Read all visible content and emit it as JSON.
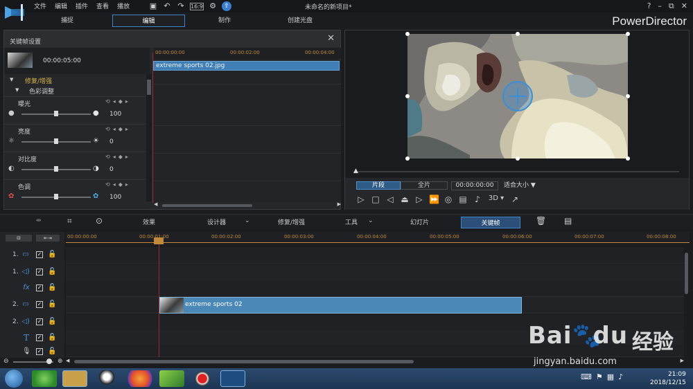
{
  "window": {
    "title": "未命名的新项目*",
    "brand": "PowerDirector",
    "controls": [
      "?",
      "–",
      "⧉",
      "✕"
    ]
  },
  "menu": [
    "文件",
    "编辑",
    "插件",
    "查看",
    "播放"
  ],
  "mode_tabs": [
    {
      "label": "捕捉",
      "active": false
    },
    {
      "label": "编辑",
      "active": true
    },
    {
      "label": "制作",
      "active": false
    },
    {
      "label": "创建光盘",
      "active": false
    }
  ],
  "keyframe_panel": {
    "title": "关键帧设置",
    "clip_time": "00:00:05:00",
    "ruler": [
      "00:00:00:00",
      "00:00:02:00",
      "00:00:04:00"
    ],
    "clip_name": "extreme sports 02.jpg",
    "section": "修复/增强",
    "subsection": "色彩调整",
    "properties": [
      {
        "name": "曝光",
        "value": "100",
        "level": 0.5
      },
      {
        "name": "亮度",
        "value": "0",
        "level": 0.5
      },
      {
        "name": "对比度",
        "value": "0",
        "level": 0.5
      },
      {
        "name": "色调",
        "value": "100",
        "level": 0.5
      }
    ]
  },
  "preview": {
    "segment_tabs": [
      {
        "label": "片段",
        "active": true
      },
      {
        "label": "全片",
        "active": false
      }
    ],
    "timecode": "00:00:00:00",
    "fit": "适合大小",
    "mode_3d": "3D"
  },
  "timeline_toolbar": {
    "effects": "效果",
    "designer": "设计器",
    "fix_enhance": "修复/增强",
    "tools": "工具",
    "slideshow": "幻灯片",
    "keyframe": "关键帧"
  },
  "timeline": {
    "ruler": [
      "00:00:00:00",
      "00:00:01:00",
      "00:00:02:00",
      "00:00:03:00",
      "00:00:04:00",
      "00:00:05:00",
      "00:00:06:00",
      "00:00:07:00",
      "00:00:08:00"
    ],
    "tracks": [
      {
        "num": "1.",
        "icon": "video-track-icon"
      },
      {
        "num": "1.",
        "icon": "audio-track-icon"
      },
      {
        "num": "",
        "icon": "fx-track-icon"
      },
      {
        "num": "2.",
        "icon": "video-track-icon"
      },
      {
        "num": "2.",
        "icon": "audio-track-icon"
      },
      {
        "num": "",
        "icon": "title-track-icon"
      },
      {
        "num": "",
        "icon": "voice-track-icon"
      }
    ],
    "clip_name": "extreme sports 02"
  },
  "taskbar": {
    "time": "21:09",
    "date": "2018/12/15"
  },
  "watermark": {
    "brand": "Bai",
    "brand_tail": "du",
    "cn": "经验",
    "url": "jingyan.baidu.com"
  }
}
